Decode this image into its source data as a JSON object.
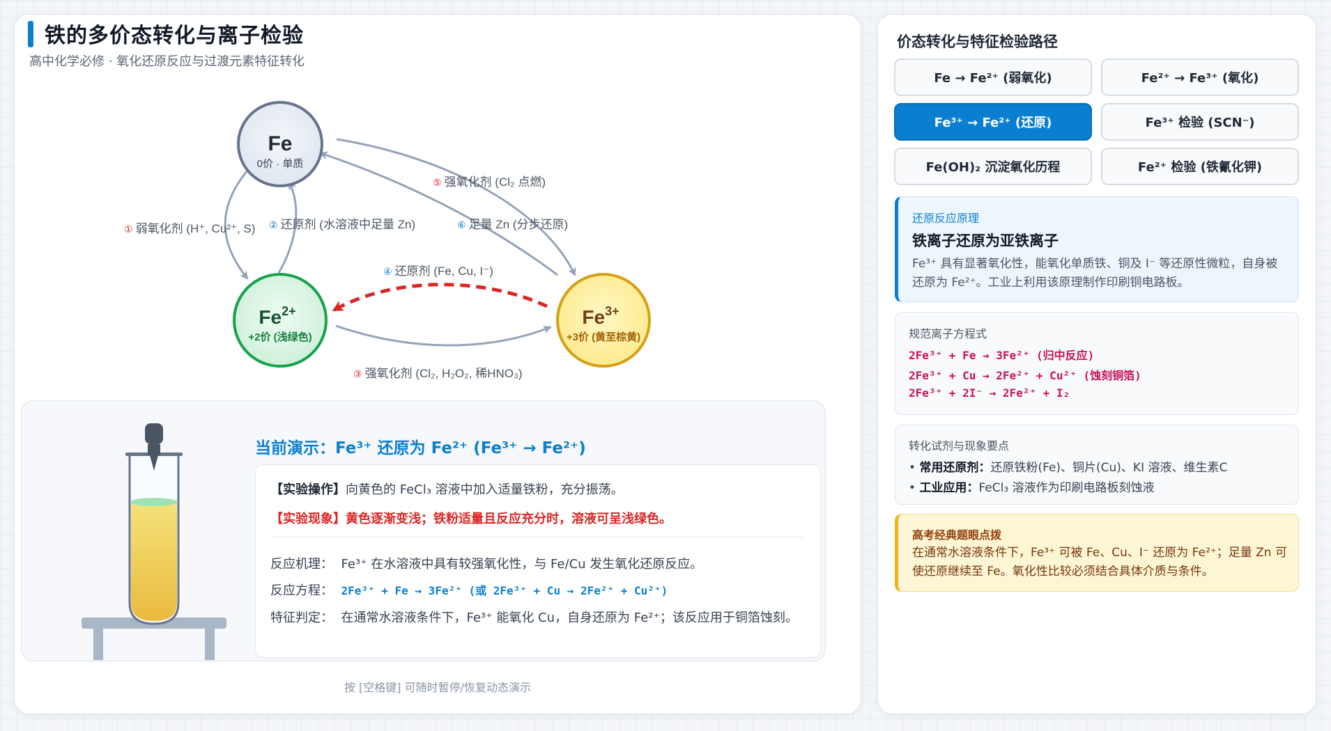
{
  "header": {
    "title": "铁的多价态转化与离子检验",
    "subtitle": "高中化学必修 · 氧化还原反应与过渡元素特征转化"
  },
  "nodes": {
    "fe": {
      "symbol": "Fe",
      "label": "0价 · 单质"
    },
    "fe2": {
      "symbol": "Fe",
      "charge": "2+",
      "label": "+2价 (浅绿色)"
    },
    "fe3": {
      "symbol": "Fe",
      "charge": "3+",
      "label": "+3价 (黄至棕黄)"
    }
  },
  "arrows": {
    "a1": {
      "num": "①",
      "text": "弱氧化剂 (H⁺, Cu²⁺, S)"
    },
    "a2": {
      "num": "②",
      "text": "还原剂 (水溶液中足量 Zn)"
    },
    "a3": {
      "num": "③",
      "text": "强氧化剂 (Cl₂, H₂O₂, 稀HNO₃)"
    },
    "a4": {
      "num": "④",
      "text": "还原剂 (Fe, Cu, I⁻)"
    },
    "a5": {
      "num": "⑤",
      "text": "强氧化剂 (Cl₂ 点燃)"
    },
    "a6": {
      "num": "⑥",
      "text": "足量 Zn (分步还原)"
    }
  },
  "demo": {
    "title": "当前演示：Fe³⁺ 还原为 Fe²⁺ (Fe³⁺ → Fe²⁺)",
    "op_label": "【实验操作】",
    "op_text": "向黄色的 FeCl₃ 溶液中加入适量铁粉，充分振荡。",
    "obs_label": "【实验现象】",
    "obs_text": "黄色逐渐变浅；铁粉适量且反应充分时，溶液可呈浅绿色。",
    "mech_key": "反应机理：",
    "mech_text": "Fe³⁺ 在水溶液中具有较强氧化性，与 Fe/Cu 发生氧化还原反应。",
    "eq_key": "反应方程：",
    "eq_text": "2Fe³⁺ + Fe → 3Fe²⁺ (或 2Fe³⁺ + Cu → 2Fe²⁺ + Cu²⁺)",
    "judge_key": "特征判定：",
    "judge_text": "在通常水溶液条件下，Fe³⁺ 能氧化 Cu，自身还原为 Fe²⁺；该反应用于铜箔蚀刻。",
    "hint": "按 [空格键] 可随时暂停/恢复动态演示",
    "tube_fill": 0.73,
    "colors": {
      "solution_top": "#f5e27a",
      "solution_bottom": "#e8b83a",
      "surface": "#9fe3b5"
    }
  },
  "sidebar": {
    "title": "价态转化与特征检验路径",
    "tabs": [
      {
        "label": "Fe → Fe²⁺ (弱氧化)",
        "active": false
      },
      {
        "label": "Fe²⁺ → Fe³⁺ (氧化)",
        "active": false
      },
      {
        "label": "Fe³⁺ → Fe²⁺ (还原)",
        "active": true
      },
      {
        "label": "Fe³⁺ 检验 (SCN⁻)",
        "active": false
      },
      {
        "label": "Fe(OH)₂ 沉淀氧化历程",
        "active": false
      },
      {
        "label": "Fe²⁺ 检验 (铁氰化钾)",
        "active": false
      }
    ],
    "principle": {
      "tag": "还原反应原理",
      "heading": "铁离子还原为亚铁离子",
      "body": "Fe³⁺ 具有显著氧化性，能氧化单质铁、铜及 I⁻ 等还原性微粒，自身被还原为 Fe²⁺。工业上利用该原理制作印刷铜电路板。"
    },
    "equations": {
      "tag": "规范离子方程式",
      "lines": [
        "2Fe³⁺ + Fe → 3Fe²⁺ (归中反应)",
        "2Fe³⁺ + Cu → 2Fe²⁺ + Cu²⁺ (蚀刻铜箔)",
        "2Fe³⁺ + 2I⁻ → 2Fe²⁺ + I₂"
      ]
    },
    "points": {
      "tag": "转化试剂与现象要点",
      "items": [
        {
          "key": "常用还原剂：",
          "text": "还原铁粉(Fe)、铜片(Cu)、KI 溶液、维生素C"
        },
        {
          "key": "工业应用：",
          "text": "FeCl₃ 溶液作为印刷电路板刻蚀液"
        }
      ]
    },
    "tip": {
      "tag": "高考经典题眼点拨",
      "body": "在通常水溶液条件下，Fe³⁺ 可被 Fe、Cu、I⁻ 还原为 Fe²⁺；足量 Zn 可使还原继续至 Fe。氧化性比较必须结合具体介质与条件。"
    }
  }
}
